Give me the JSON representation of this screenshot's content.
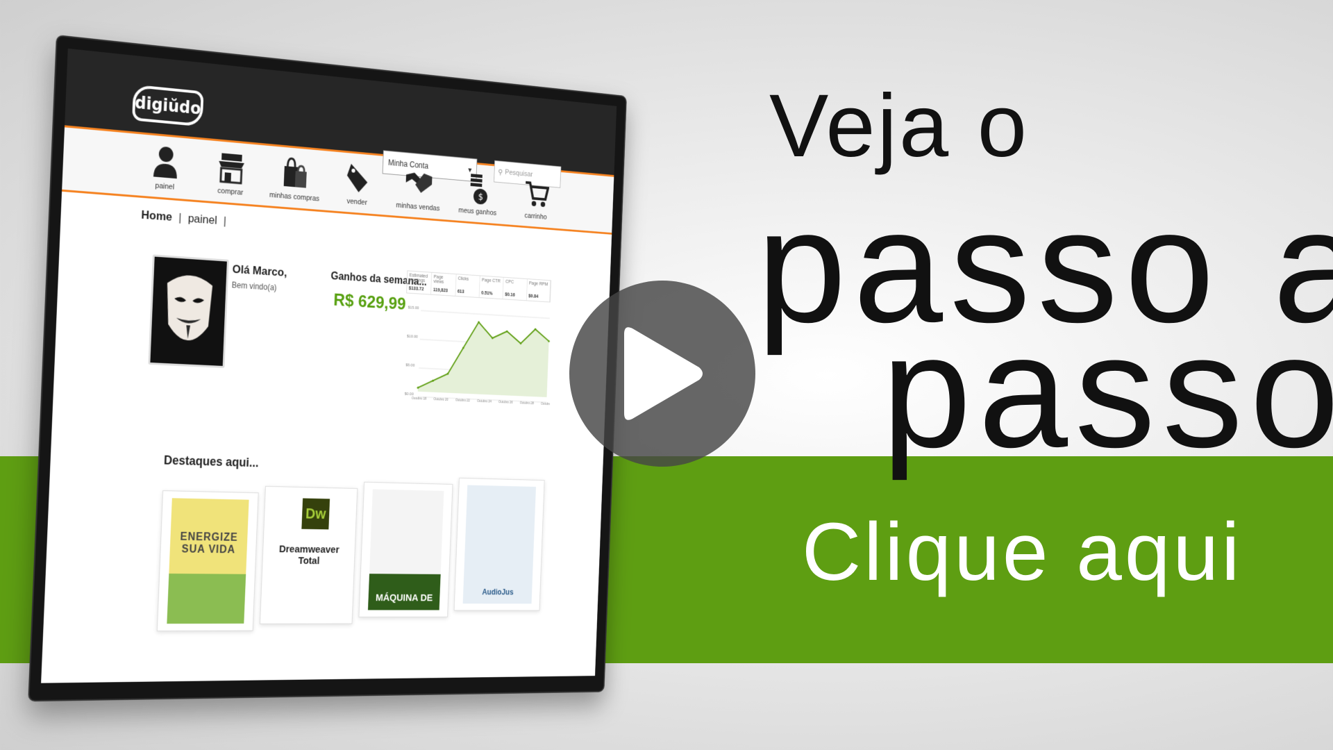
{
  "hero": {
    "line1": "Veja o",
    "line2": "passo a",
    "line3": "passo",
    "cta": "Clique aqui"
  },
  "colors": {
    "band_green": "#5e9e12",
    "accent_orange": "#f58220",
    "earnings_green": "#57a010"
  },
  "site": {
    "logo": "digiŭdo",
    "account_select": "Minha Conta",
    "search_placeholder": "Pesquisar",
    "nav": [
      {
        "label": "painel",
        "icon": "user-icon"
      },
      {
        "label": "comprar",
        "icon": "shop-icon"
      },
      {
        "label": "minhas compras",
        "icon": "shopping-bags-icon"
      },
      {
        "label": "vender",
        "icon": "sale-tag-icon"
      },
      {
        "label": "minhas vendas",
        "icon": "handshake-icon"
      },
      {
        "label": "meus ganhos",
        "icon": "coins-icon"
      },
      {
        "label": "carrinho",
        "icon": "cart-icon"
      }
    ],
    "breadcrumb": {
      "home": "Home",
      "current": "painel"
    },
    "greeting": "Olá Marco,",
    "welcome": "Bem vindo(a)",
    "earnings_title": "Ganhos da semana...",
    "earnings_value": "R$ 629,99",
    "stats": {
      "headers": [
        "Estimated earnings",
        "Page views",
        "Clicks",
        "Page CTR",
        "CPC",
        "Page RPM"
      ],
      "values": [
        "$133.72",
        "119,823",
        "613",
        "0.51%",
        "$0.16",
        "$0.84"
      ]
    },
    "featured_title": "Destaques aqui...",
    "products": [
      {
        "title": "ENERGIZE SUA VIDA"
      },
      {
        "title": "Dreamweaver Total",
        "badge": "Dw"
      },
      {
        "title": "MÁQUINA DE"
      },
      {
        "title": "AudioJus"
      }
    ]
  },
  "chart_data": {
    "type": "area",
    "x": [
      "Outubro 18",
      "Outubro 20",
      "Outubro 22",
      "Outubro 24",
      "Outubro 26",
      "Outubro 28",
      "Outubro 30"
    ],
    "values": [
      2,
      6,
      10,
      24,
      38,
      30,
      34,
      28,
      36,
      30
    ],
    "y_ticks": [
      "$15.00",
      "$10.00",
      "$5.00",
      "$0.00"
    ],
    "ylim": [
      0,
      45
    ],
    "grid": true
  }
}
